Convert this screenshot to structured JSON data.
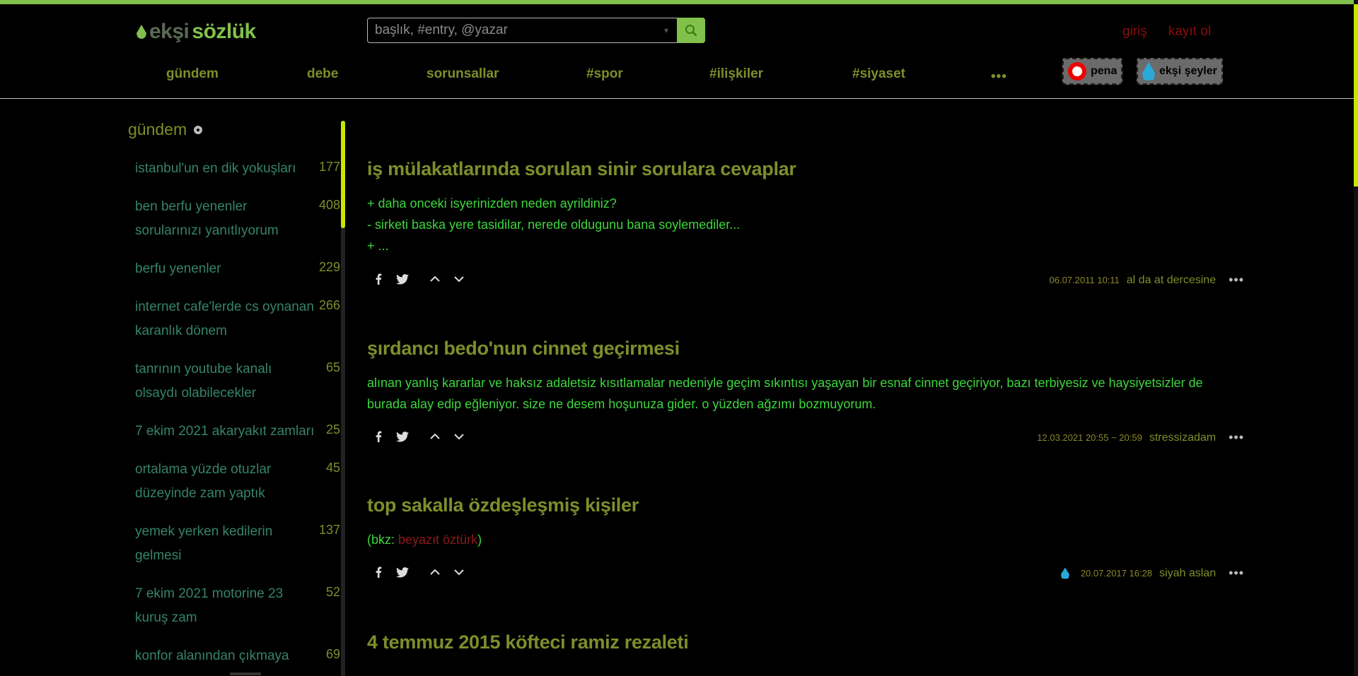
{
  "logo": {
    "part1": "ekşi",
    "part2": "sözlük"
  },
  "search": {
    "placeholder": "başlık, #entry, @yazar"
  },
  "auth": {
    "login": "giriş",
    "register": "kayıt ol"
  },
  "nav": {
    "items": [
      "gündem",
      "debe",
      "sorunsallar",
      "#spor",
      "#ilişkiler",
      "#siyaset"
    ],
    "more": "•••"
  },
  "chips": {
    "pena": "pena",
    "eksi_seyler": "ekşi şeyler"
  },
  "sidebar": {
    "title": "gündem",
    "topics": [
      {
        "title": "istanbul'un en dik yokuşları",
        "count": "177"
      },
      {
        "title": "ben berfu yenenler sorularınızı yanıtlıyorum",
        "count": "408"
      },
      {
        "title": "berfu yenenler",
        "count": "229"
      },
      {
        "title": "internet cafe'lerde cs oynanan karanlık dönem",
        "count": "266"
      },
      {
        "title": "tanrının youtube kanalı olsaydı olabilecekler",
        "count": "65"
      },
      {
        "title": "7 ekim 2021 akaryakıt zamları",
        "count": "25"
      },
      {
        "title": "ortalama yüzde otuzlar düzeyinde zam yaptık",
        "count": "45"
      },
      {
        "title": "yemek yerken kedilerin gelmesi",
        "count": "137"
      },
      {
        "title": "7 ekim 2021 motorine 23 kuruş zam",
        "count": "52"
      },
      {
        "title": "konfor alanından çıkmaya",
        "count": "69"
      }
    ]
  },
  "entries": [
    {
      "title": "iş mülakatlarında sorulan sinir sorulara cevaplar",
      "lines": [
        "+ daha onceki isyerinizden neden ayrildiniz?",
        "- sirketi baska yere tasidilar, nerede oldugunu bana soylemediler...",
        "+ ..."
      ],
      "date": "06.07.2011 10:11",
      "author": "al da at dercesine"
    },
    {
      "title": "şırdancı bedo'nun cinnet geçirmesi",
      "lines": [
        "alınan yanlış kararlar ve haksız adaletsiz kısıtlamalar nedeniyle geçim sıkıntısı yaşayan bir esnaf cinnet geçiriyor, bazı terbiyesiz ve haysiyetsizler de",
        "burada alay edip eğleniyor. size ne desem hoşunuza gider. o yüzden ağzımı bozmuyorum."
      ],
      "date": "12.03.2021 20:55 ~ 20:59",
      "author": "stressizadam"
    },
    {
      "title": "top sakalla özdeşleşmiş kişiler",
      "bkz_prefix": "(bkz: ",
      "bkz_link": "beyazıt öztürk",
      "bkz_suffix": ")",
      "date": "20.07.2017 16:28",
      "author": "siyah aslan"
    },
    {
      "title": "4 temmuz 2015 köfteci ramiz rezaleti"
    }
  ],
  "more_label": "•••",
  "icons": [
    "facebook-icon",
    "twitter-icon",
    "upvote-icon",
    "downvote-icon",
    "search-icon",
    "gear-icon"
  ]
}
